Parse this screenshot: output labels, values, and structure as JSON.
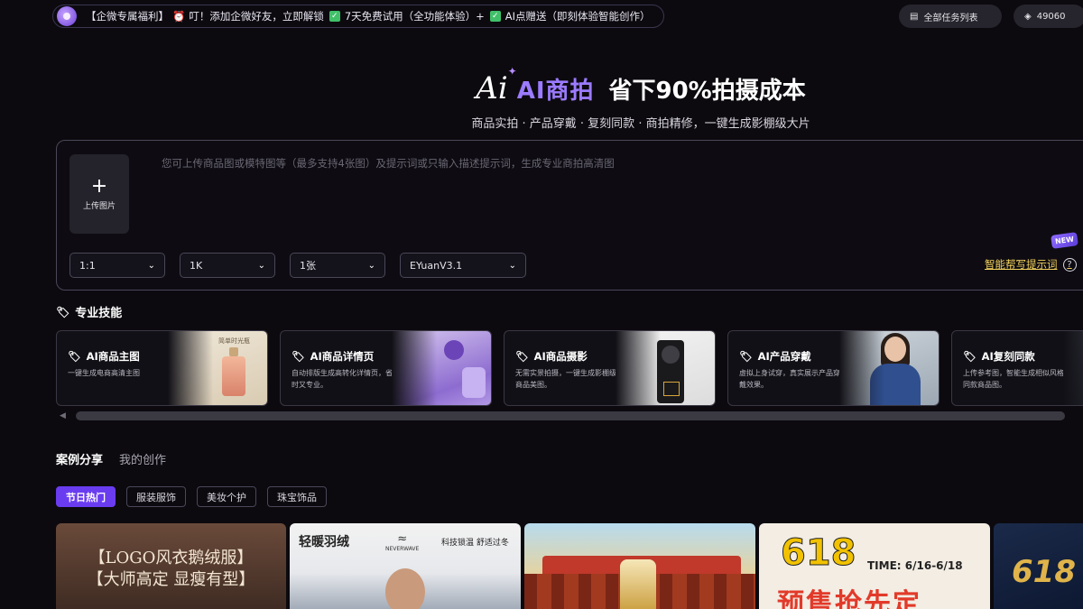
{
  "promo": {
    "text_a": "【企微专属福利】",
    "text_b": "叮！添加企微好友，立即解锁",
    "text_c": "7天免费试用（全功能体验）+",
    "text_d": "AI点赠送（即刻体验智能创作）"
  },
  "top": {
    "tasks_label": "全部任务列表",
    "points": "49060"
  },
  "hero": {
    "mark": "Ai",
    "ai_label": "AI商拍",
    "slogan": "省下90%拍摄成本",
    "subtitle": "商品实拍 · 产品穿戴 · 复刻同款 · 商拍精修，一键生成影棚级大片"
  },
  "panel": {
    "upload_label": "上传图片",
    "placeholder": "您可上传商品图或模特图等（最多支持4张图）及提示词或只输入描述提示词，生成专业商拍高清图",
    "selects": [
      {
        "value": "1:1"
      },
      {
        "value": "1K"
      },
      {
        "value": "1张"
      },
      {
        "value": "EYuanV3.1"
      }
    ],
    "new_badge": "NEW",
    "smart_label": "智能帮写提示词",
    "help": "?"
  },
  "skills": {
    "title": "专业技能",
    "cards": [
      {
        "title": "AI商品主图",
        "desc": "一键生成电商高清主图"
      },
      {
        "title": "AI商品详情页",
        "desc": "自动排版生成高转化详情页，省时又专业。"
      },
      {
        "title": "AI商品摄影",
        "desc": "无需实景拍摄，一键生成影棚级商品美图。"
      },
      {
        "title": "AI产品穿戴",
        "desc": "虚拟上身试穿，真实展示产品穿戴效果。"
      },
      {
        "title": "AI复刻同款",
        "desc": "上传参考图，智能生成相似风格同款商品图。"
      }
    ],
    "card1_img_text": "简单时光瓶"
  },
  "tabs": {
    "items": [
      {
        "label": "案例分享"
      },
      {
        "label": "我的创作"
      }
    ]
  },
  "filters": {
    "items": [
      {
        "label": "节日热门"
      },
      {
        "label": "服装服饰"
      },
      {
        "label": "美妆个护"
      },
      {
        "label": "珠宝饰品"
      }
    ]
  },
  "gallery": {
    "g1_line1": "【LOGO风衣鹅绒服】",
    "g1_line2": "【大师高定 显瘦有型】",
    "g2_title": "轻暖羽绒",
    "g2_brand": "NEVERWAVE",
    "g2_tag": "科技锁温 舒适过冬",
    "g4_num": "618",
    "g4_time": "TIME: 6/16-6/18",
    "g4_pre": "预售抢先定",
    "g5_num": "618"
  },
  "colors": {
    "accent": "#6a3cf0",
    "hero_ai": "#9b7bff",
    "smart_link": "#f4d35e",
    "background": "#0c0a0f"
  }
}
